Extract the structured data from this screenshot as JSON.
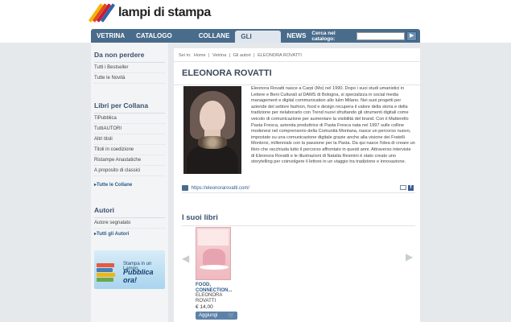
{
  "brand": {
    "name": "lampi di stampa",
    "stripe_colors": [
      "#f2b705",
      "#e84a1c",
      "#c21e3a",
      "#3066a8"
    ]
  },
  "nav": {
    "items": [
      {
        "label": "VETRINA"
      },
      {
        "label": "CATALOGO LIBRI"
      },
      {
        "label": "COLLANE"
      },
      {
        "label": "GLI AUTORI",
        "active": true
      },
      {
        "label": "NEWS"
      }
    ],
    "search_label": "Cerca nel catalogo:",
    "search_value": "",
    "go_icon": "arrow-right-icon"
  },
  "sidebar": {
    "sections": [
      {
        "title": "Da non perdere",
        "links": [
          "Tutti i Bestseller",
          "Tutte le Novità"
        ]
      },
      {
        "title": "Libri per Collana",
        "links": [
          "TiPubblica",
          "TuttiAUTORI",
          "Altri titoli",
          "Titoli in coedizione",
          "Ristampe Anastatiche",
          "A proposito di classici"
        ],
        "strong_link": "Tutte le Collane"
      },
      {
        "title": "Autori",
        "links": [
          "Autore segnalato"
        ],
        "strong_link": "Tutti gli Autori"
      }
    ],
    "banner": {
      "line1": "Stampa in un Lampo.",
      "line2": "Pubblica ora!"
    }
  },
  "main": {
    "breadcrumb": [
      "Sei in:",
      "Home",
      "|",
      "Vetrina",
      "|",
      "Gli autori",
      "|",
      "ELEONORA ROVATTI"
    ],
    "title": "ELEONORA ROVATTI",
    "bio": "Eleonora Rovatti nasce a Carpi (Mo) nel 1990. Dopo i suoi studi umanistici in Lettere e Beni Culturali al DAMS di Bologna, si specializza in social media management e digital communication allo Iulm Milano. Nei suoi progetti per aziende del settore fashion, food e design recupera il valore della storia e della tradizione per rielaborarlo con Trend nuovi sfruttando gli strumenti digitali come veicolo di comunicazione per aumentare la visibilità del brand. Con il Matterello Pasta Fresca, azienda produttrice di Pasta Fresca nata nel 1997 sulle colline modenesi nel comprensorio della Comunità Montana, nasce un percorso nuovo, impostato su una comunicazione digitale grazie anche alla visione dei Fratelli Montorsi, millennials con la passione per la Pasta. Da qui nasce l'idea di creare un libro che racchiuda tutto il percorso affrontato in questi anni. Attraverso interviste di Eleonora Rovatti e le illustrazioni di Natalia Resmini è stato creato uno storytelling per coinvolgere il lettore in un viaggio tra tradizione e innovazione.",
    "website": "https://eleonorarovatti.com/",
    "books_title": "I suoi libri",
    "books": [
      {
        "title": "FOOD, CONNECTION...",
        "author": "ELEONORA ROVATTI",
        "price": "€ 14,00",
        "button": "Aggiungi"
      }
    ]
  }
}
